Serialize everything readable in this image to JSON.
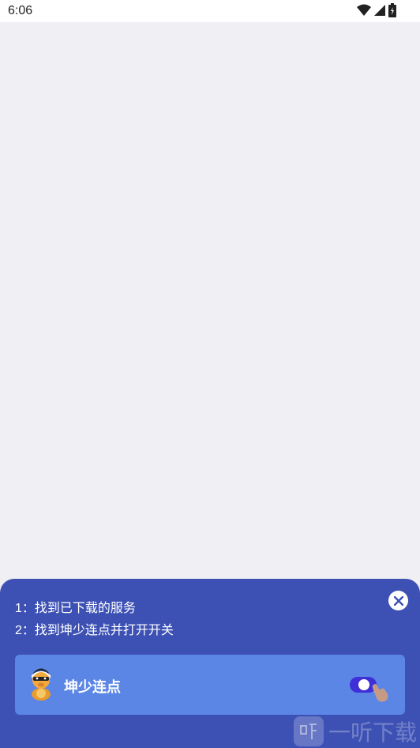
{
  "status_bar": {
    "time": "6:06"
  },
  "instructions": {
    "step1": "1：找到已下载的服务",
    "step2": "2：找到坤少连点并打开开关"
  },
  "app_card": {
    "name": "坤少连点",
    "toggle_on": true
  },
  "watermark": {
    "text": "一听下载"
  },
  "colors": {
    "sheet": "#3d51b5",
    "card": "#5b86e5",
    "toggle": "#3f2fd6",
    "background": "#f0eff4"
  }
}
